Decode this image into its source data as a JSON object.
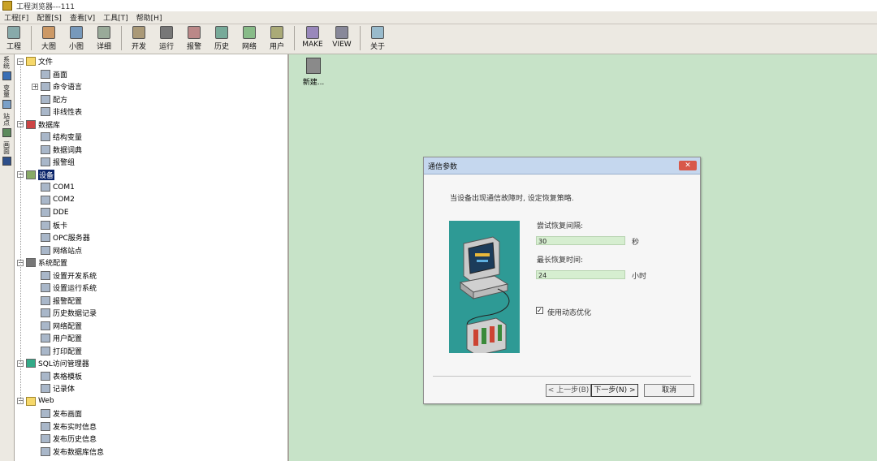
{
  "window": {
    "title": "工程浏览器---111"
  },
  "menu": [
    "工程[F]",
    "配置[S]",
    "查看[V]",
    "工具[T]",
    "帮助[H]"
  ],
  "toolbar": {
    "groups": [
      [
        {
          "label": "工程",
          "icon": "project-icon"
        }
      ],
      [
        {
          "label": "大图",
          "icon": "large-icons-icon"
        },
        {
          "label": "小图",
          "icon": "small-icons-icon"
        },
        {
          "label": "详细",
          "icon": "details-icon"
        }
      ],
      [
        {
          "label": "开发",
          "icon": "develop-icon"
        },
        {
          "label": "运行",
          "icon": "run-icon"
        },
        {
          "label": "报警",
          "icon": "alarm-icon"
        },
        {
          "label": "历史",
          "icon": "history-icon"
        },
        {
          "label": "网络",
          "icon": "network-icon"
        },
        {
          "label": "用户",
          "icon": "user-icon"
        }
      ],
      [
        {
          "label": "MAKE",
          "icon": "make-icon"
        },
        {
          "label": "VIEW",
          "icon": "view-icon"
        }
      ],
      [
        {
          "label": "关于",
          "icon": "about-icon"
        }
      ]
    ]
  },
  "left_tabs": [
    {
      "label": "系统",
      "icon": "system-tab-icon"
    },
    {
      "label": "变量",
      "icon": "variable-tab-icon"
    },
    {
      "label": "站点",
      "icon": "station-tab-icon"
    },
    {
      "label": "画面",
      "icon": "screen-tab-icon"
    }
  ],
  "tree": [
    {
      "label": "文件",
      "level": 0,
      "toggle": "⊟",
      "icon": "folder-icon"
    },
    {
      "label": "画面",
      "level": 1,
      "icon": "screen-icon"
    },
    {
      "label": "命令语言",
      "level": 1,
      "toggle": "⊞",
      "icon": "command-language-icon"
    },
    {
      "label": "配方",
      "level": 1,
      "icon": "recipe-icon"
    },
    {
      "label": "非线性表",
      "level": 1,
      "icon": "nonlinear-table-icon"
    },
    {
      "label": "数据库",
      "level": 0,
      "toggle": "⊟",
      "icon": "database-icon"
    },
    {
      "label": "结构变量",
      "level": 1,
      "icon": "struct-variable-icon"
    },
    {
      "label": "数据词典",
      "level": 1,
      "icon": "data-dictionary-icon"
    },
    {
      "label": "报警组",
      "level": 1,
      "icon": "alarm-group-icon"
    },
    {
      "label": "设备",
      "level": 0,
      "toggle": "⊟",
      "icon": "device-icon",
      "selected": true
    },
    {
      "label": "COM1",
      "level": 1,
      "icon": "com-port-icon"
    },
    {
      "label": "COM2",
      "level": 1,
      "icon": "com-port-icon"
    },
    {
      "label": "DDE",
      "level": 1,
      "icon": "dde-icon"
    },
    {
      "label": "板卡",
      "level": 1,
      "icon": "board-icon"
    },
    {
      "label": "OPC服务器",
      "level": 1,
      "icon": "opc-server-icon"
    },
    {
      "label": "网络站点",
      "level": 1,
      "icon": "network-station-icon"
    },
    {
      "label": "系统配置",
      "level": 0,
      "toggle": "⊟",
      "icon": "tools-icon"
    },
    {
      "label": "设置开发系统",
      "level": 1,
      "icon": "dev-settings-icon"
    },
    {
      "label": "设置运行系统",
      "level": 1,
      "icon": "run-settings-icon"
    },
    {
      "label": "报警配置",
      "level": 1,
      "icon": "alarm-config-icon"
    },
    {
      "label": "历史数据记录",
      "level": 1,
      "icon": "history-record-icon"
    },
    {
      "label": "网络配置",
      "level": 1,
      "icon": "network-config-icon"
    },
    {
      "label": "用户配置",
      "level": 1,
      "icon": "user-config-icon"
    },
    {
      "label": "打印配置",
      "level": 1,
      "icon": "print-config-icon"
    },
    {
      "label": "SQL访问管理器",
      "level": 0,
      "toggle": "⊟",
      "icon": "sql-manager-icon"
    },
    {
      "label": "表格模板",
      "level": 1,
      "icon": "table-template-icon"
    },
    {
      "label": "记录体",
      "level": 1,
      "icon": "record-icon"
    },
    {
      "label": "Web",
      "level": 0,
      "toggle": "⊟",
      "icon": "folder-icon"
    },
    {
      "label": "发布画面",
      "level": 1,
      "icon": "publish-screen-icon"
    },
    {
      "label": "发布实时信息",
      "level": 1,
      "icon": "publish-realtime-icon"
    },
    {
      "label": "发布历史信息",
      "level": 1,
      "icon": "publish-history-icon"
    },
    {
      "label": "发布数据库信息",
      "level": 1,
      "icon": "publish-database-icon"
    }
  ],
  "content": {
    "new_item_label": "新建..."
  },
  "dialog": {
    "title": "通信参数",
    "close": "✕",
    "instruction": "当设备出现通信故障时, 设定恢复策略.",
    "retry_interval_label": "尝试恢复间隔:",
    "retry_interval_value": "30",
    "retry_interval_unit": "秒",
    "max_recovery_label": "最长恢复时间:",
    "max_recovery_value": "24",
    "max_recovery_unit": "小时",
    "dynamic_optimization_label": "使用动态优化",
    "dynamic_optimization_checked": true,
    "back_button": "< 上一步(B)",
    "next_button": "下一步(N) >",
    "cancel_button": "取消"
  }
}
